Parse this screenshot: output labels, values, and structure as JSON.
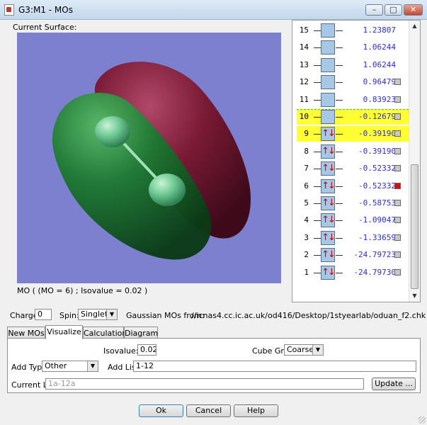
{
  "window": {
    "title": "G3:M1 - MOs"
  },
  "surface": {
    "label": "Current Surface:",
    "status": "MO ( (MO = 6) ; Isovalue = 0.02 )"
  },
  "orbitals": [
    {
      "num": "15",
      "energy": "1.23807",
      "occupied": false,
      "checkbox": false,
      "checked": false,
      "highlight": false
    },
    {
      "num": "14",
      "energy": "1.06244",
      "occupied": false,
      "checkbox": false,
      "checked": false,
      "highlight": false
    },
    {
      "num": "13",
      "energy": "1.06244",
      "occupied": false,
      "checkbox": false,
      "checked": false,
      "highlight": false
    },
    {
      "num": "12",
      "energy": "0.96479",
      "occupied": false,
      "checkbox": true,
      "checked": false,
      "highlight": false
    },
    {
      "num": "11",
      "energy": "0.83923",
      "occupied": false,
      "checkbox": true,
      "checked": false,
      "highlight": false
    },
    {
      "num": "10",
      "energy": "-0.12679",
      "occupied": false,
      "checkbox": true,
      "checked": false,
      "highlight": true
    },
    {
      "num": "9",
      "energy": "-0.39190",
      "occupied": true,
      "checkbox": true,
      "checked": false,
      "highlight": true
    },
    {
      "num": "8",
      "energy": "-0.39190",
      "occupied": true,
      "checkbox": true,
      "checked": false,
      "highlight": false
    },
    {
      "num": "7",
      "energy": "-0.52332",
      "occupied": true,
      "checkbox": true,
      "checked": false,
      "highlight": false
    },
    {
      "num": "6",
      "energy": "-0.52332",
      "occupied": true,
      "checkbox": true,
      "checked": true,
      "highlight": false
    },
    {
      "num": "5",
      "energy": "-0.58753",
      "occupied": true,
      "checkbox": true,
      "checked": false,
      "highlight": false
    },
    {
      "num": "4",
      "energy": "-1.09047",
      "occupied": true,
      "checkbox": true,
      "checked": false,
      "highlight": false
    },
    {
      "num": "3",
      "energy": "-1.33659",
      "occupied": true,
      "checkbox": true,
      "checked": false,
      "highlight": false
    },
    {
      "num": "2",
      "energy": "-24.79723",
      "occupied": true,
      "checkbox": true,
      "checked": false,
      "highlight": false
    },
    {
      "num": "1",
      "energy": "-24.79730",
      "occupied": true,
      "checkbox": true,
      "checked": false,
      "highlight": false
    }
  ],
  "occupied_glyph": "↑↓",
  "controls": {
    "charge_label": "Charge:",
    "charge_value": "0",
    "spin_label": "Spin:",
    "spin_value": "Singlet",
    "source_label": "Gaussian MOs from:",
    "source_path": "//icnas4.cc.ic.ac.uk/od416/Desktop/1styearlab/oduan_f2.chk"
  },
  "tabs": [
    "New MOs",
    "Visualize",
    "Calculation",
    "Diagram"
  ],
  "visualize": {
    "isovalue_label": "Isovalue:",
    "isovalue": "0.02",
    "cube_grid_label": "Cube Grid:",
    "cube_grid": "Coarse",
    "add_type_label": "Add Type:",
    "add_type": "Other",
    "add_list_label": "Add List:",
    "add_list": "1-12",
    "current_list_label": "Current List:",
    "current_list": "1a-12a",
    "update_label": "Update ..."
  },
  "buttons": {
    "ok": "Ok",
    "cancel": "Cancel",
    "help": "Help"
  },
  "colors": {
    "surface_bg": "#7d7fcf",
    "positive_lobe": "#1e7a33",
    "negative_lobe": "#7a1a35",
    "highlight": "#ffff33",
    "energy_text": "#2b2bd8"
  }
}
